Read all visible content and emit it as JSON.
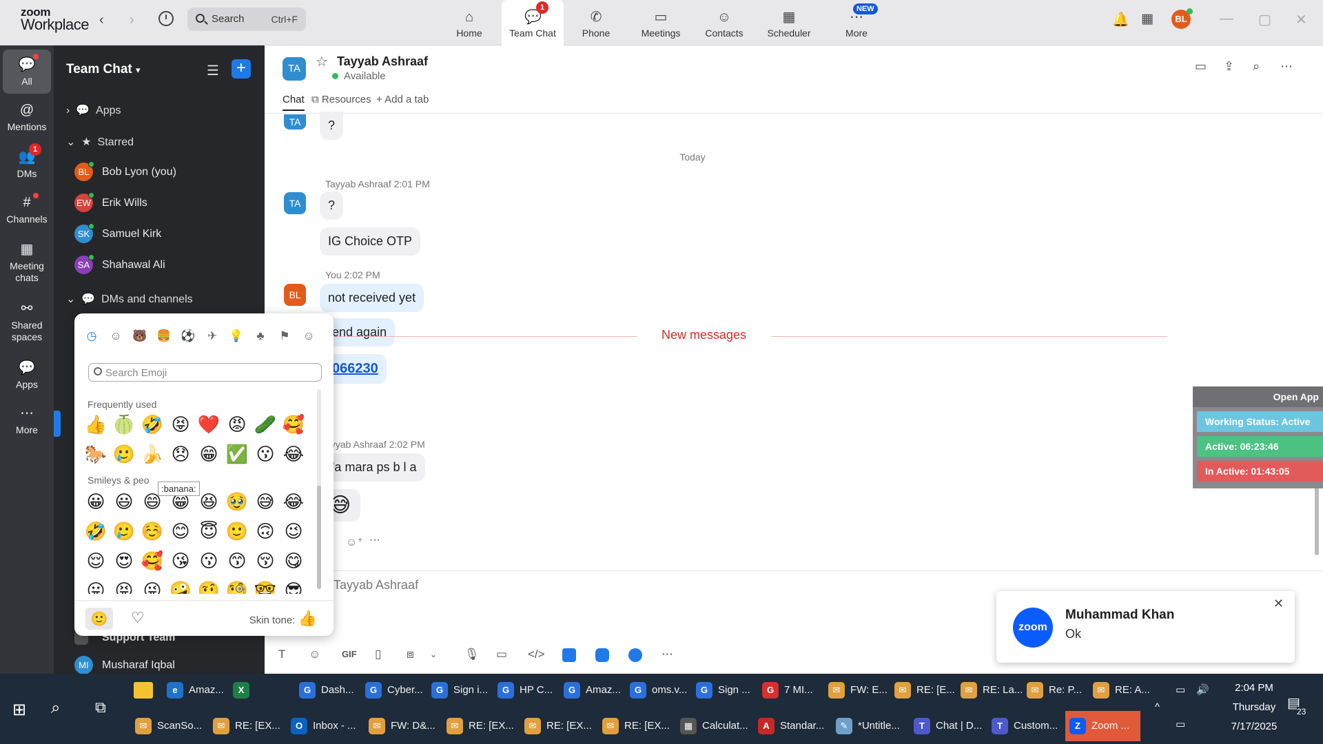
{
  "app": {
    "logo_line1": "zoom",
    "logo_line2": "Workplace",
    "search_placeholder": "Search",
    "search_shortcut": "Ctrl+F"
  },
  "topnav": [
    {
      "label": "Home",
      "icon": "home-icon"
    },
    {
      "label": "Team Chat",
      "icon": "chat-icon",
      "badge": "1",
      "active": true
    },
    {
      "label": "Phone",
      "icon": "phone-icon"
    },
    {
      "label": "Meetings",
      "icon": "video-icon"
    },
    {
      "label": "Contacts",
      "icon": "contacts-icon"
    },
    {
      "label": "Scheduler",
      "icon": "calendar-icon"
    },
    {
      "label": "More",
      "icon": "more-icon"
    }
  ],
  "new_badge": "NEW",
  "user_initials": "BL",
  "rail": [
    {
      "label": "All",
      "icon": "chat-bubble-icon"
    },
    {
      "label": "Mentions",
      "icon": "at-icon"
    },
    {
      "label": "DMs",
      "icon": "people-icon",
      "badge": "1"
    },
    {
      "label": "Channels",
      "icon": "hash-icon"
    },
    {
      "label": "Meeting chats",
      "icon": "calendar-icon"
    },
    {
      "label": "Shared spaces",
      "icon": "share-icon"
    },
    {
      "label": "Apps",
      "icon": "apps-icon"
    },
    {
      "label": "More",
      "icon": "more-icon"
    }
  ],
  "sidebar": {
    "title": "Team Chat",
    "apps_label": "Apps",
    "starred_label": "Starred",
    "starred": [
      {
        "initials": "BL",
        "name": "Bob Lyon (you)",
        "color": "#e35b1a"
      },
      {
        "initials": "EW",
        "name": "Erik Wills",
        "color": "#d6433b"
      },
      {
        "initials": "SK",
        "name": "Samuel Kirk",
        "color": "#2f8ecf"
      },
      {
        "initials": "SA",
        "name": "Shahawal Ali",
        "color": "#8a3fb5"
      }
    ],
    "dms_label": "DMs and channels",
    "support_team": "Support Team",
    "musharaf_initials": "MI",
    "musharaf": "Musharaf Iqbal"
  },
  "chat": {
    "initials": "TA",
    "name": "Tayyab Ashraaf",
    "status": "Available",
    "tabs": [
      "Chat",
      "Resources",
      "+ Add a tab"
    ],
    "today_label": "Today",
    "first_bubble": "?",
    "msg1_meta": "Tayyab Ashraaf 2:01 PM",
    "msg1_bubbles": [
      "?",
      "IG Choice OTP"
    ],
    "msg2_meta": "You 2:02 PM",
    "msg2_bubbles": [
      "not received yet",
      "end again",
      "066230"
    ],
    "new_messages": "New messages",
    "msg3_meta": "ayyab Ashraaf 2:02 PM",
    "msg3_bubble": "'a mara ps b l a",
    "msg3_emoji": "😅",
    "input_placeholder": "Tayyab Ashraaf",
    "gif_label": "GIF"
  },
  "emoji_picker": {
    "search_placeholder": "Search Emoji",
    "frequently_used_label": "Frequently used",
    "smileys_label": "Smileys & peo",
    "tooltip": ":banana:",
    "skin_tone_label": "Skin tone:",
    "skin_tone_emoji": "👍",
    "frequently_used": [
      "👍",
      "🍈",
      "🤣",
      "😝",
      "❤️",
      "😡",
      "🥒",
      "🥰",
      "🐎",
      "🥲",
      "🍌",
      "😞",
      "😁",
      "✅",
      "😗",
      "😂"
    ],
    "smileys": [
      "😀",
      "😃",
      "😄",
      "😁",
      "😆",
      "🥹",
      "😅",
      "😂",
      "🤣",
      "🥲",
      "☺️",
      "😊",
      "😇",
      "🙂",
      "🙃",
      "😉",
      "😌",
      "😍",
      "🥰",
      "😘",
      "😗",
      "😙",
      "😚",
      "😋",
      "😛",
      "😝",
      "😜",
      "🤪",
      "🤨",
      "🧐",
      "🤓",
      "😎"
    ]
  },
  "widget": {
    "header": "Open App",
    "working_status": "Working Status: Active",
    "active": "Active: 06:23:46",
    "inactive": "In Active: 01:43:05"
  },
  "notification": {
    "logo": "zoom",
    "title": "Muhammad Khan",
    "body": "Ok"
  },
  "taskbar": {
    "row1": [
      {
        "label": "Amaz...",
        "color": "#1e73c8",
        "g": "e"
      },
      {
        "label": "",
        "color": "#1d7f45",
        "g": "X"
      },
      {
        "label": "Dash...",
        "color": "#2a6fdc",
        "g": "G"
      },
      {
        "label": "Cyber...",
        "color": "#2a6fdc",
        "g": "G"
      },
      {
        "label": "Sign i...",
        "color": "#2a6fdc",
        "g": "G"
      },
      {
        "label": "HP C...",
        "color": "#2a6fdc",
        "g": "G"
      },
      {
        "label": "Amaz...",
        "color": "#2a6fdc",
        "g": "G"
      },
      {
        "label": "oms.v...",
        "color": "#2a6fdc",
        "g": "G"
      },
      {
        "label": "Sign ...",
        "color": "#2a6fdc",
        "g": "G"
      },
      {
        "label": "7 MI...",
        "color": "#d63030",
        "g": "G"
      },
      {
        "label": "FW: E...",
        "color": "#e0a040",
        "g": "✉"
      },
      {
        "label": "RE: [E...",
        "color": "#e0a040",
        "g": "✉"
      },
      {
        "label": "RE: La...",
        "color": "#e0a040",
        "g": "✉"
      },
      {
        "label": "Re: P...",
        "color": "#e0a040",
        "g": "✉"
      },
      {
        "label": "RE: A...",
        "color": "#e0a040",
        "g": "✉"
      }
    ],
    "row2": [
      {
        "label": "ScanSo...",
        "color": "#e0a040",
        "g": "✉"
      },
      {
        "label": "RE: [EX...",
        "color": "#e0a040",
        "g": "✉"
      },
      {
        "label": "Inbox - ...",
        "color": "#0b62c4",
        "g": "O"
      },
      {
        "label": "FW: D&...",
        "color": "#e0a040",
        "g": "✉"
      },
      {
        "label": "RE: [EX...",
        "color": "#e0a040",
        "g": "✉"
      },
      {
        "label": "RE: [EX...",
        "color": "#e0a040",
        "g": "✉"
      },
      {
        "label": "RE: [EX...",
        "color": "#e0a040",
        "g": "✉"
      },
      {
        "label": "Calculat...",
        "color": "#555",
        "g": "▦"
      },
      {
        "label": "Standar...",
        "color": "#c62828",
        "g": "A"
      },
      {
        "label": "*Untitle...",
        "color": "#6fa0c8",
        "g": "✎"
      },
      {
        "label": "Chat | D...",
        "color": "#5059c9",
        "g": "T"
      },
      {
        "label": "Custom...",
        "color": "#5059c9",
        "g": "T"
      },
      {
        "label": "Zoom ...",
        "color": "#0b5cff",
        "g": "Z",
        "active": true
      }
    ],
    "time": "2:04 PM",
    "day": "Thursday",
    "date": "7/17/2025",
    "notif_count": "23"
  }
}
